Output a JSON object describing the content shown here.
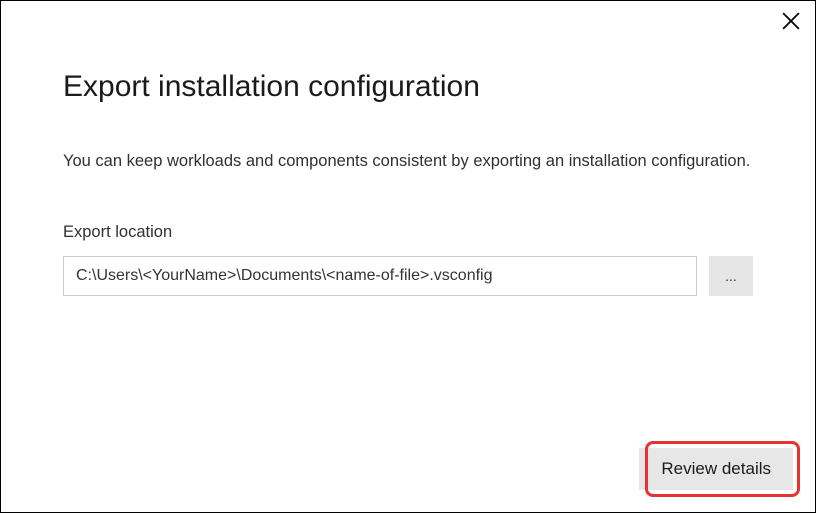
{
  "dialog": {
    "title": "Export installation configuration",
    "description": "You can keep workloads and components consistent by exporting an installation configuration.",
    "field_label": "Export location",
    "path_value": "C:\\Users\\<YourName>\\Documents\\<name-of-file>.vsconfig",
    "browse_label": "...",
    "review_button": "Review details"
  }
}
